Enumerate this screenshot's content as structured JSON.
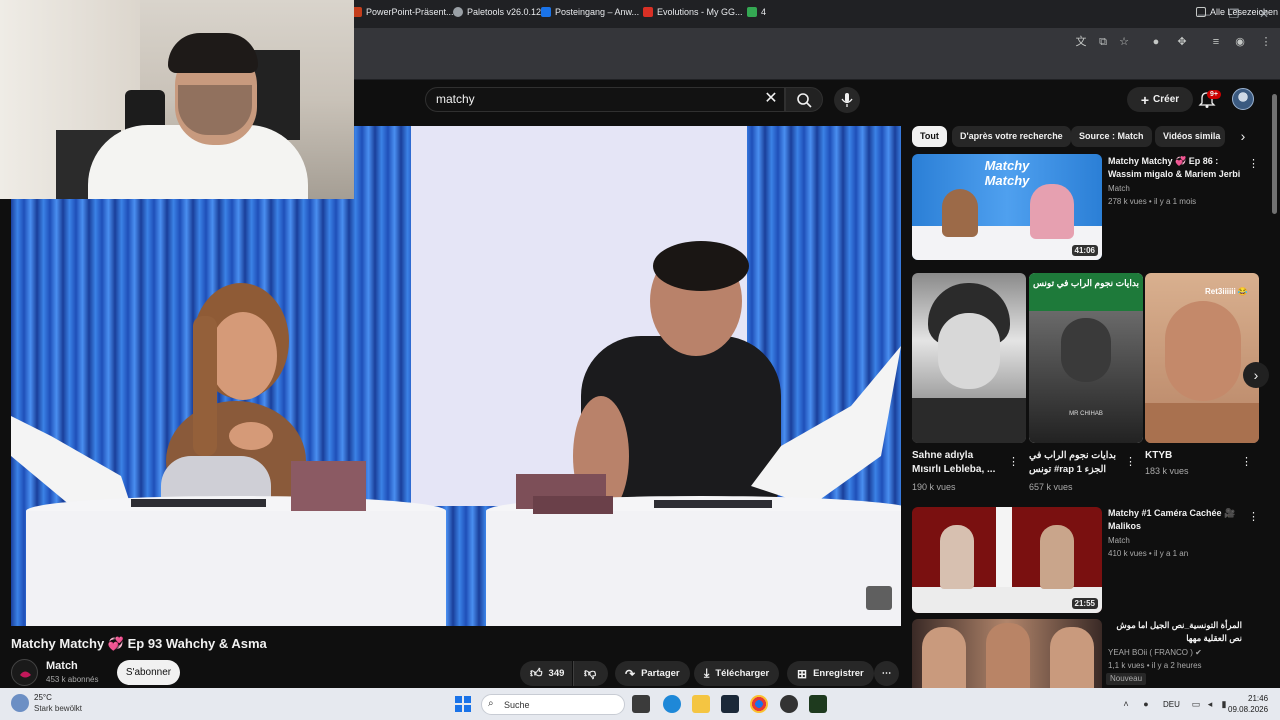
{
  "browser": {
    "bookmarks": [
      {
        "label": "PowerPoint-Präsent...",
        "color": "#c43e1c"
      },
      {
        "label": "Paletools v26.0.12",
        "color": "#9aa0a6"
      },
      {
        "label": "Posteingang – Anw...",
        "color": "#1a73e8"
      },
      {
        "label": "Evolutions - My GG...",
        "color": "#d93025"
      },
      {
        "label": "4",
        "color": "#34a853"
      }
    ],
    "all_bookmarks": "Alle Lesezeichen"
  },
  "youtube": {
    "search_value": "matchy",
    "create_label": "Créer",
    "notif_badge": "9+",
    "chips": [
      "Tout",
      "D'après votre recherche",
      "Source : Match",
      "Vidéos simila"
    ],
    "video": {
      "title": "Matchy Matchy 💞 Ep 93 Wahchy & Asma",
      "channel": "Match",
      "subscribers": "453 k abonnés",
      "subscribe_label": "S'abonner",
      "likes": "349",
      "share_label": "Partager",
      "download_label": "Télécharger",
      "save_label": "Enregistrer"
    },
    "related": [
      {
        "title": "Matchy Matchy 💞 Ep 86 : Wassim migalo & Mariem Jerbi",
        "channel": "Match",
        "meta": "278 k vues • il y a 1 mois",
        "duration": "41:06"
      },
      {
        "title": "Matchy #1 Caméra Cachée 🎥 Malikos",
        "channel": "Match",
        "meta": "410 k vues • il y a 1 an",
        "duration": "21:55"
      },
      {
        "title": "المرأة التونسية_نص الجيل اما موش نص العقلية مهها",
        "channel": "YEAH BOii ( FRANCO ) ✔",
        "meta": "1,1 k vues • il y a 2 heures",
        "badge": "Nouveau"
      }
    ],
    "shorts": [
      {
        "title": "Sahne adıyla Mısırlı Lebleba, ...",
        "views": "190 k vues"
      },
      {
        "title": "بدايات نجوم الراب في تونس #rap الجزء 1",
        "views": "657 k vues",
        "overlay": "بدايات نجوم الراب في تونس",
        "sub": "MR CHIHAB"
      },
      {
        "title": "KTYB",
        "views": "183 k vues",
        "overlay": "Ret3iiiiii 😂"
      }
    ]
  },
  "taskbar": {
    "temp": "25°C",
    "weather": "Stark bewölkt",
    "search_placeholder": "Suche",
    "lang": "DEU",
    "time": "21:46",
    "date": "09.08.2026"
  }
}
